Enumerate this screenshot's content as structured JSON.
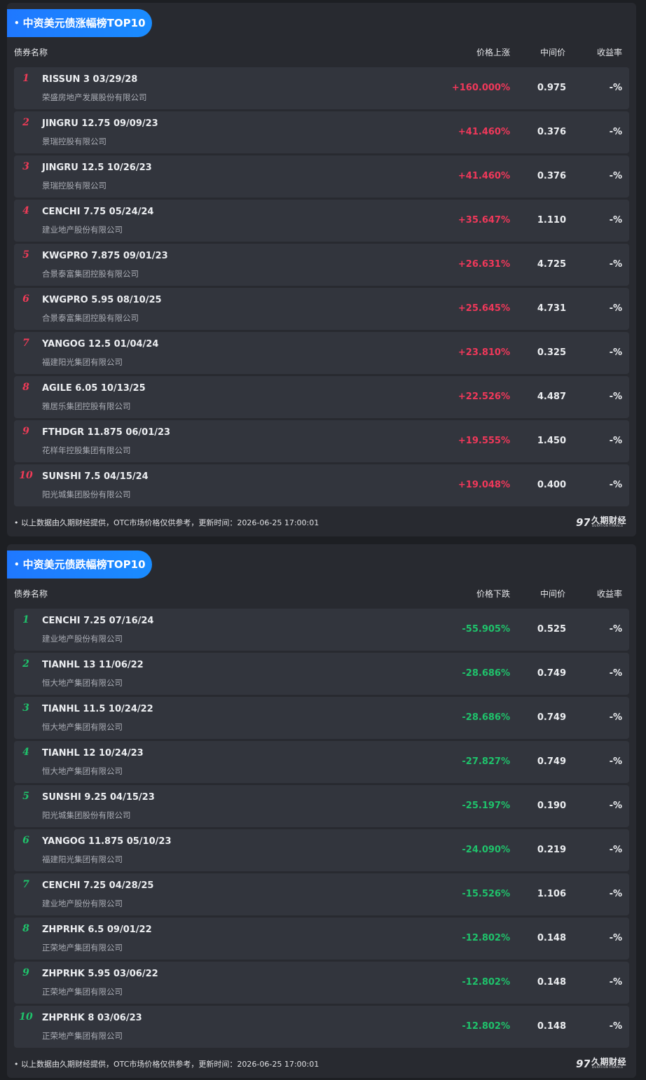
{
  "gainers": {
    "title": "中资美元债涨幅榜TOP10",
    "headers": {
      "name": "债券名称",
      "change": "价格上涨",
      "mid": "中间价",
      "yield": "收益率"
    },
    "rows": [
      {
        "rank": "1",
        "code": "RISSUN 3 03/29/28",
        "issuer": "荣盛房地产发展股份有限公司",
        "change": "+160.000%",
        "mid": "0.975",
        "yield": "-%"
      },
      {
        "rank": "2",
        "code": "JINGRU 12.75 09/09/23",
        "issuer": "景瑞控股有限公司",
        "change": "+41.460%",
        "mid": "0.376",
        "yield": "-%"
      },
      {
        "rank": "3",
        "code": "JINGRU 12.5 10/26/23",
        "issuer": "景瑞控股有限公司",
        "change": "+41.460%",
        "mid": "0.376",
        "yield": "-%"
      },
      {
        "rank": "4",
        "code": "CENCHI 7.75 05/24/24",
        "issuer": "建业地产股份有限公司",
        "change": "+35.647%",
        "mid": "1.110",
        "yield": "-%"
      },
      {
        "rank": "5",
        "code": "KWGPRO 7.875 09/01/23",
        "issuer": "合景泰富集团控股有限公司",
        "change": "+26.631%",
        "mid": "4.725",
        "yield": "-%"
      },
      {
        "rank": "6",
        "code": "KWGPRO 5.95 08/10/25",
        "issuer": "合景泰富集团控股有限公司",
        "change": "+25.645%",
        "mid": "4.731",
        "yield": "-%"
      },
      {
        "rank": "7",
        "code": "YANGOG 12.5 01/04/24",
        "issuer": "福建阳光集团有限公司",
        "change": "+23.810%",
        "mid": "0.325",
        "yield": "-%"
      },
      {
        "rank": "8",
        "code": "AGILE 6.05 10/13/25",
        "issuer": "雅居乐集团控股有限公司",
        "change": "+22.526%",
        "mid": "4.487",
        "yield": "-%"
      },
      {
        "rank": "9",
        "code": "FTHDGR 11.875 06/01/23",
        "issuer": "花样年控股集团有限公司",
        "change": "+19.555%",
        "mid": "1.450",
        "yield": "-%"
      },
      {
        "rank": "10",
        "code": "SUNSHI 7.5 04/15/24",
        "issuer": "阳光城集团股份有限公司",
        "change": "+19.048%",
        "mid": "0.400",
        "yield": "-%"
      }
    ],
    "footer": "以上数据由久期财经提供，OTC市场价格仅供参考，更新时间：2026-06-25 17:00:01"
  },
  "losers": {
    "title": "中资美元债跌幅榜TOP10",
    "headers": {
      "name": "债券名称",
      "change": "价格下跌",
      "mid": "中间价",
      "yield": "收益率"
    },
    "rows": [
      {
        "rank": "1",
        "code": "CENCHI 7.25 07/16/24",
        "issuer": "建业地产股份有限公司",
        "change": "-55.905%",
        "mid": "0.525",
        "yield": "-%"
      },
      {
        "rank": "2",
        "code": "TIANHL 13 11/06/22",
        "issuer": "恒大地产集团有限公司",
        "change": "-28.686%",
        "mid": "0.749",
        "yield": "-%"
      },
      {
        "rank": "3",
        "code": "TIANHL 11.5 10/24/22",
        "issuer": "恒大地产集团有限公司",
        "change": "-28.686%",
        "mid": "0.749",
        "yield": "-%"
      },
      {
        "rank": "4",
        "code": "TIANHL 12 10/24/23",
        "issuer": "恒大地产集团有限公司",
        "change": "-27.827%",
        "mid": "0.749",
        "yield": "-%"
      },
      {
        "rank": "5",
        "code": "SUNSHI 9.25 04/15/23",
        "issuer": "阳光城集团股份有限公司",
        "change": "-25.197%",
        "mid": "0.190",
        "yield": "-%"
      },
      {
        "rank": "6",
        "code": "YANGOG 11.875 05/10/23",
        "issuer": "福建阳光集团有限公司",
        "change": "-24.090%",
        "mid": "0.219",
        "yield": "-%"
      },
      {
        "rank": "7",
        "code": "CENCHI 7.25 04/28/25",
        "issuer": "建业地产股份有限公司",
        "change": "-15.526%",
        "mid": "1.106",
        "yield": "-%"
      },
      {
        "rank": "8",
        "code": "ZHPRHK 6.5 09/01/22",
        "issuer": "正荣地产集团有限公司",
        "change": "-12.802%",
        "mid": "0.148",
        "yield": "-%"
      },
      {
        "rank": "9",
        "code": "ZHPRHK 5.95 03/06/22",
        "issuer": "正荣地产集团有限公司",
        "change": "-12.802%",
        "mid": "0.148",
        "yield": "-%"
      },
      {
        "rank": "10",
        "code": "ZHPRHK 8 03/06/23",
        "issuer": "正荣地产集团有限公司",
        "change": "-12.802%",
        "mid": "0.148",
        "yield": "-%"
      }
    ],
    "footer": "以上数据由久期财经提供，OTC市场价格仅供参考，更新时间：2026-06-25 17:00:01"
  },
  "brand": {
    "logo_text": "97",
    "name": "久期财经",
    "subtitle": "DURATION FINANCE",
    "icon": "duration-finance-logo"
  },
  "colors": {
    "gain": "#f0385a",
    "loss": "#1fc26b",
    "accent": "#1f78ff"
  }
}
